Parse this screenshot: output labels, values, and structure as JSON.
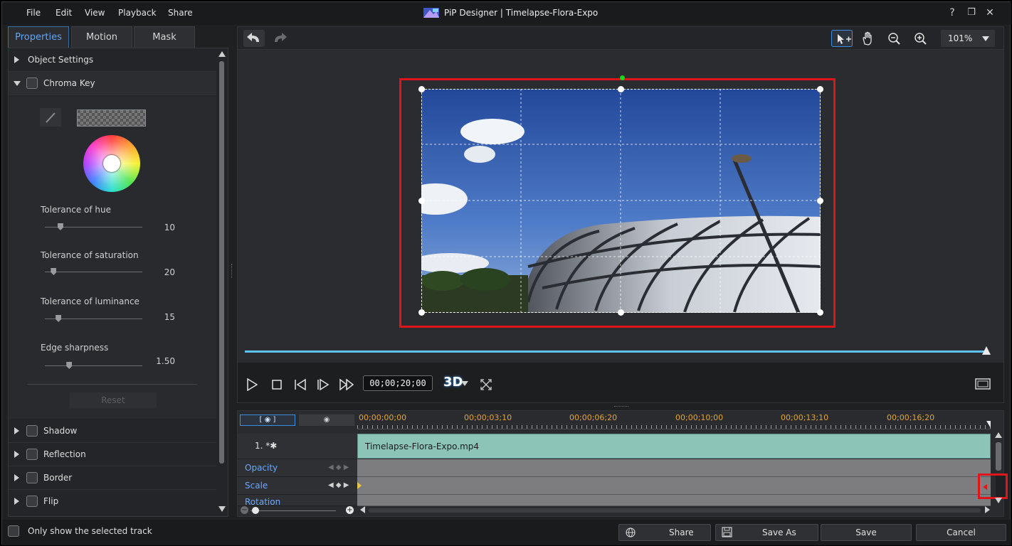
{
  "app": {
    "title": "PiP Designer | Timelapse-Flora-Expo",
    "colors": {
      "accent": "#5aa9ff",
      "highlight": "#e0141a",
      "timeline_clip": "#8cc4b8",
      "ruler": "#e0a43a"
    }
  },
  "menu": {
    "items": [
      "File",
      "Edit",
      "View",
      "Playback",
      "Share"
    ]
  },
  "window_controls": {
    "help": "?",
    "restore": "❐",
    "close": "✕"
  },
  "tabs": [
    {
      "label": "Properties",
      "active": true
    },
    {
      "label": "Motion",
      "active": false
    },
    {
      "label": "Mask",
      "active": false
    }
  ],
  "sections": {
    "object_settings": "Object Settings",
    "chroma_key": "Chroma Key",
    "shadow": "Shadow",
    "reflection": "Reflection",
    "border": "Border",
    "flip": "Flip"
  },
  "chroma": {
    "sliders": [
      {
        "label": "Tolerance of hue",
        "value": "10",
        "level": 0.16
      },
      {
        "label": "Tolerance of saturation",
        "value": "20",
        "level": 0.09
      },
      {
        "label": "Tolerance of luminance",
        "value": "15",
        "level": 0.14
      },
      {
        "label": "Edge sharpness",
        "value": "1.50",
        "level": 0.25
      }
    ],
    "reset_label": "Reset"
  },
  "preview": {
    "zoom": "101%",
    "timecode": "00;00;20;00",
    "mode_3d": "3D"
  },
  "timeline": {
    "ruler": [
      "00;00;00;00",
      "00;00;03;10",
      "00;00;06;20",
      "00;00;10;00",
      "00;00;13;10",
      "00;00;16;20"
    ],
    "track_name": "1. *✱",
    "clip_name": "Timelapse-Flora-Expo.mp4",
    "keyframe_tracks": [
      "Opacity",
      "Scale",
      "Rotation"
    ]
  },
  "footer": {
    "only_selected": "Only show the selected track",
    "share": "Share",
    "save_as": "Save As",
    "save": "Save",
    "cancel": "Cancel"
  }
}
